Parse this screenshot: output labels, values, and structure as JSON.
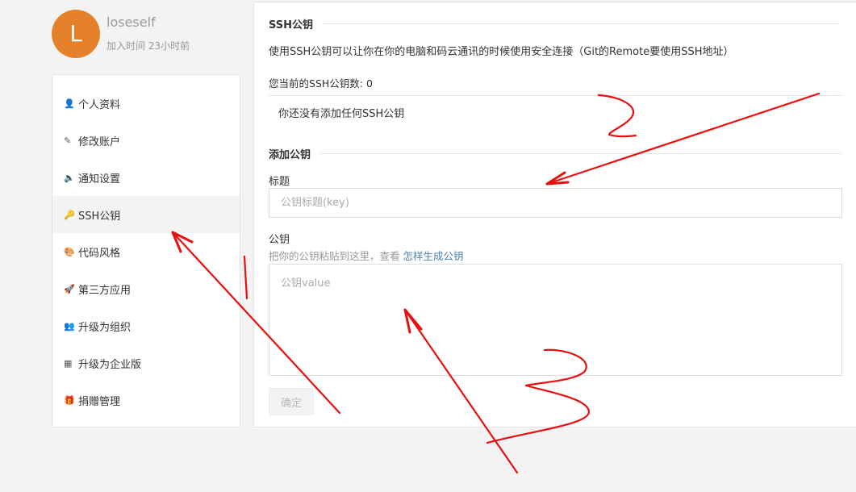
{
  "profile": {
    "avatar_letter": "L",
    "username": "loseself",
    "joined": "加入时间 23小时前"
  },
  "sidebar": {
    "items": [
      {
        "label": "个人资料",
        "icon": "user-icon",
        "glyph": "👤"
      },
      {
        "label": "修改账户",
        "icon": "pencil-icon",
        "glyph": "✎"
      },
      {
        "label": "通知设置",
        "icon": "speaker-icon",
        "glyph": "🔈"
      },
      {
        "label": "SSH公钥",
        "icon": "key-icon",
        "glyph": "🔑",
        "active": true
      },
      {
        "label": "代码风格",
        "icon": "palette-icon",
        "glyph": "🎨"
      },
      {
        "label": "第三方应用",
        "icon": "rocket-icon",
        "glyph": "🚀"
      },
      {
        "label": "升级为组织",
        "icon": "group-icon",
        "glyph": "👥"
      },
      {
        "label": "升级为企业版",
        "icon": "building-icon",
        "glyph": "▦"
      },
      {
        "label": "捐赠管理",
        "icon": "gift-icon",
        "glyph": "🎁"
      }
    ]
  },
  "ssh": {
    "title": "SSH公钥",
    "description": "使用SSH公钥可以让你在你的电脑和码云通讯的时候使用安全连接（Git的Remote要使用SSH地址）",
    "count_label": "您当前的SSH公钥数: 0",
    "empty_message": "你还没有添加任何SSH公钥"
  },
  "add_key": {
    "title": "添加公钥",
    "title_label": "标题",
    "title_placeholder": "公钥标题(key)",
    "key_label": "公钥",
    "hint_text": "把你的公钥粘贴到这里，查看 ",
    "hint_link": "怎样生成公钥",
    "key_placeholder": "公钥value",
    "confirm_label": "确定"
  },
  "colors": {
    "avatar_bg": "#e6812b",
    "annotation": "#e8100f",
    "link": "#4a7fa9"
  }
}
